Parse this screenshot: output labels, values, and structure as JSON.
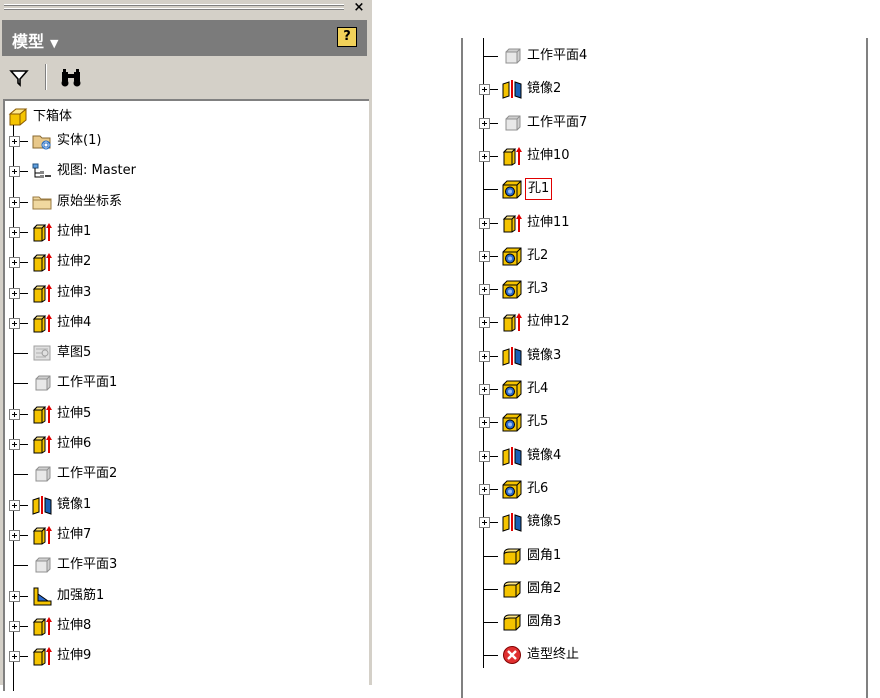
{
  "panel": {
    "title": "模型",
    "close_glyph": "×",
    "help_glyph": "?",
    "toolbar": [
      {
        "icon": "filter-icon"
      },
      {
        "icon": "find-binoculars-icon"
      }
    ]
  },
  "left_tree": {
    "root": {
      "label": "下箱体",
      "icon": "part-icon"
    },
    "items": [
      {
        "label": "实体(1)",
        "icon": "solid-bodies-icon",
        "expandable": true
      },
      {
        "label": "视图: Master",
        "icon": "view-icon",
        "expandable": true
      },
      {
        "label": "原始坐标系",
        "icon": "folder-icon",
        "expandable": true
      },
      {
        "label": "拉伸1",
        "icon": "extrude-icon",
        "expandable": true
      },
      {
        "label": "拉伸2",
        "icon": "extrude-icon",
        "expandable": true
      },
      {
        "label": "拉伸3",
        "icon": "extrude-icon",
        "expandable": true
      },
      {
        "label": "拉伸4",
        "icon": "extrude-icon",
        "expandable": true
      },
      {
        "label": "草图5",
        "icon": "sketch-icon",
        "expandable": false
      },
      {
        "label": "工作平面1",
        "icon": "work-plane-icon",
        "expandable": false
      },
      {
        "label": "拉伸5",
        "icon": "extrude-icon",
        "expandable": true
      },
      {
        "label": "拉伸6",
        "icon": "extrude-icon",
        "expandable": true
      },
      {
        "label": "工作平面2",
        "icon": "work-plane-icon",
        "expandable": false
      },
      {
        "label": "镜像1",
        "icon": "mirror-icon",
        "expandable": true
      },
      {
        "label": "拉伸7",
        "icon": "extrude-icon",
        "expandable": true
      },
      {
        "label": "工作平面3",
        "icon": "work-plane-icon",
        "expandable": false
      },
      {
        "label": "加强筋1",
        "icon": "rib-icon",
        "expandable": true
      },
      {
        "label": "拉伸8",
        "icon": "extrude-icon",
        "expandable": true
      },
      {
        "label": "拉伸9",
        "icon": "extrude-icon",
        "expandable": true
      }
    ]
  },
  "right_tree": {
    "items": [
      {
        "label": "工作平面4",
        "icon": "work-plane-icon",
        "expandable": false
      },
      {
        "label": "镜像2",
        "icon": "mirror-icon",
        "expandable": true
      },
      {
        "label": "工作平面7",
        "icon": "work-plane-icon",
        "expandable": true
      },
      {
        "label": "拉伸10",
        "icon": "extrude-icon",
        "expandable": true
      },
      {
        "label": "孔1",
        "icon": "hole-icon",
        "expandable": false,
        "selected": true
      },
      {
        "label": "拉伸11",
        "icon": "extrude-icon",
        "expandable": true
      },
      {
        "label": "孔2",
        "icon": "hole-icon",
        "expandable": true
      },
      {
        "label": "孔3",
        "icon": "hole-icon",
        "expandable": true
      },
      {
        "label": "拉伸12",
        "icon": "extrude-icon",
        "expandable": true
      },
      {
        "label": "镜像3",
        "icon": "mirror-icon",
        "expandable": true
      },
      {
        "label": "孔4",
        "icon": "hole-icon",
        "expandable": true
      },
      {
        "label": "孔5",
        "icon": "hole-icon",
        "expandable": true
      },
      {
        "label": "镜像4",
        "icon": "mirror-icon",
        "expandable": true
      },
      {
        "label": "孔6",
        "icon": "hole-icon",
        "expandable": true
      },
      {
        "label": "镜像5",
        "icon": "mirror-icon",
        "expandable": true
      },
      {
        "label": "圆角1",
        "icon": "fillet-icon",
        "expandable": false
      },
      {
        "label": "圆角2",
        "icon": "fillet-icon",
        "expandable": false
      },
      {
        "label": "圆角3",
        "icon": "fillet-icon",
        "expandable": false
      },
      {
        "label": "造型终止",
        "icon": "end-of-part-icon",
        "expandable": false
      }
    ]
  },
  "colors": {
    "panel_bg": "#d4d0c8",
    "titlebar_bg": "#7b7b7b",
    "feature_yellow": "#f5c400",
    "extrude_arrow": "#e00000",
    "selection_border": "#e00000"
  }
}
